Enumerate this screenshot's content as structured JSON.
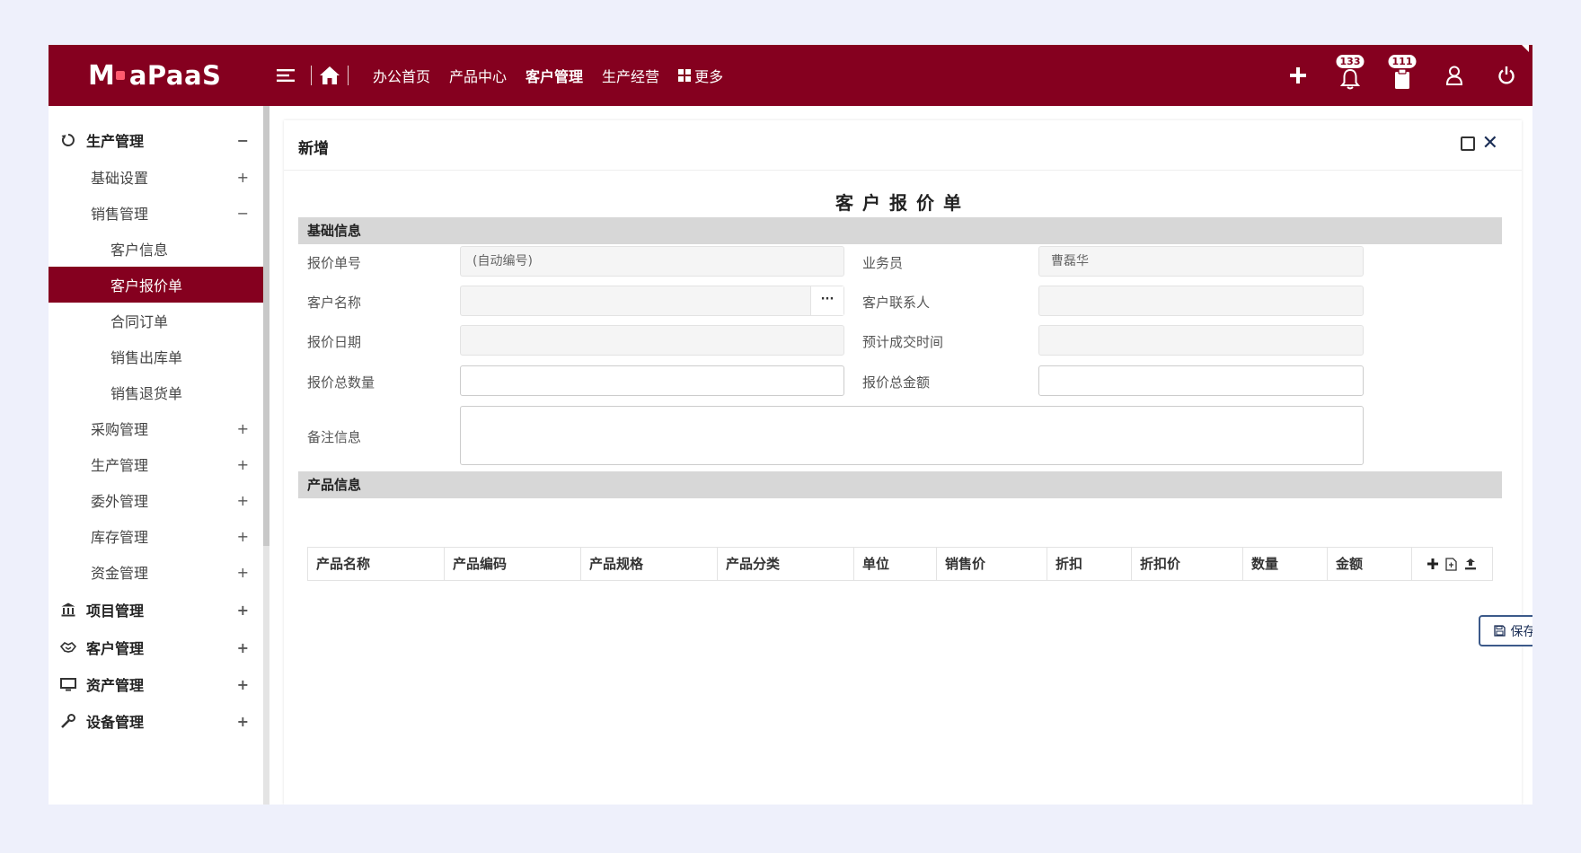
{
  "brand": {
    "logo_mark": "M",
    "logo_text": "aPaaS"
  },
  "nav": {
    "items": [
      {
        "label": "办公首页",
        "active": false
      },
      {
        "label": "产品中心",
        "active": false
      },
      {
        "label": "客户管理",
        "active": true
      },
      {
        "label": "生产经营",
        "active": false
      }
    ],
    "more_label": "更多"
  },
  "topright": {
    "notifications_count": "133",
    "messages_count": "111"
  },
  "sidebar": {
    "items": [
      {
        "label": "生产管理",
        "level": 1,
        "toggle": "−",
        "icon": "recycle-icon"
      },
      {
        "label": "基础设置",
        "level": 2,
        "toggle": "+"
      },
      {
        "label": "销售管理",
        "level": 2,
        "toggle": "−"
      },
      {
        "label": "客户信息",
        "level": 3,
        "toggle": ""
      },
      {
        "label": "客户报价单",
        "level": 3,
        "toggle": "",
        "active": true
      },
      {
        "label": "合同订单",
        "level": 3,
        "toggle": ""
      },
      {
        "label": "销售出库单",
        "level": 3,
        "toggle": ""
      },
      {
        "label": "销售退货单",
        "level": 3,
        "toggle": ""
      },
      {
        "label": "采购管理",
        "level": 2,
        "toggle": "+"
      },
      {
        "label": "生产管理",
        "level": 2,
        "toggle": "+"
      },
      {
        "label": "委外管理",
        "level": 2,
        "toggle": "+"
      },
      {
        "label": "库存管理",
        "level": 2,
        "toggle": "+"
      },
      {
        "label": "资金管理",
        "level": 2,
        "toggle": "+"
      },
      {
        "label": "项目管理",
        "level": 1,
        "toggle": "+",
        "icon": "bank-icon"
      },
      {
        "label": "客户管理",
        "level": 1,
        "toggle": "+",
        "icon": "handshake-icon"
      },
      {
        "label": "资产管理",
        "level": 1,
        "toggle": "+",
        "icon": "monitor-icon"
      },
      {
        "label": "设备管理",
        "level": 1,
        "toggle": "+",
        "icon": "wrench-icon"
      }
    ]
  },
  "panel": {
    "title": "新增",
    "form_title": "客户报价单"
  },
  "basic_section": {
    "title": "基础信息",
    "fields": {
      "quote_no": {
        "label": "报价单号",
        "value": "(自动编号)"
      },
      "salesperson": {
        "label": "业务员",
        "value": "曹磊华"
      },
      "customer_name": {
        "label": "客户名称",
        "value": "",
        "lookup": "···"
      },
      "customer_contact": {
        "label": "客户联系人",
        "value": ""
      },
      "quote_date": {
        "label": "报价日期",
        "value": ""
      },
      "expected_deal_time": {
        "label": "预计成交时间",
        "value": ""
      },
      "total_qty": {
        "label": "报价总数量",
        "value": ""
      },
      "total_amount": {
        "label": "报价总金额",
        "value": ""
      },
      "remarks": {
        "label": "备注信息",
        "value": ""
      }
    }
  },
  "product_section": {
    "title": "产品信息",
    "columns": [
      "产品名称",
      "产品编码",
      "产品规格",
      "产品分类",
      "单位",
      "销售价",
      "折扣",
      "折扣价",
      "数量",
      "金额"
    ]
  },
  "actions": {
    "save_label": "保存"
  }
}
